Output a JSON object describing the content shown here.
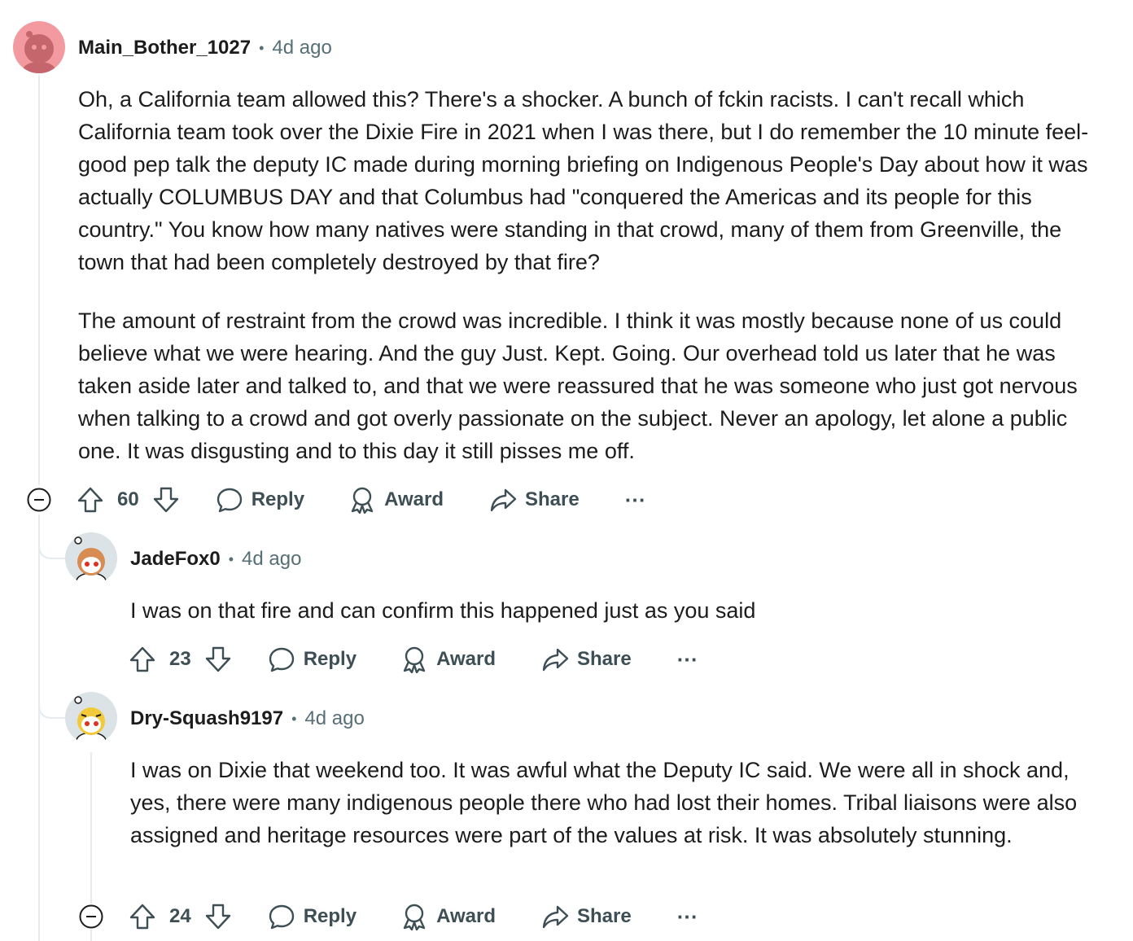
{
  "colors": {
    "text": "#1c1c1c",
    "meta": "#576f76",
    "action": "#3d4f55",
    "thread_line": "#e5ebee",
    "avatar1_bg": "#f39aa1",
    "avatar2_bg": "#dbe3e6",
    "avatar3_bg": "#dbe3e6"
  },
  "comments": [
    {
      "username": "Main_Bother_1027",
      "separator": "•",
      "time": "4d ago",
      "paragraphs": [
        "Oh, a California team allowed this? There's a shocker. A bunch of fckin racists. I can't recall which California team took over the Dixie Fire in 2021 when I was there, but I do remember the 10 minute feel-good pep talk the deputy IC made during morning briefing on Indigenous People's Day about how it was actually COLUMBUS DAY and that Columbus had \"conquered the Americas and its people for this country.\" You know how many natives were standing in that crowd, many of them from Greenville, the town that had been completely destroyed by that fire?",
        "The amount of restraint from the crowd was incredible. I think it was mostly because none of us could believe what we were hearing. And the guy Just. Kept. Going. Our overhead told us later that he was taken aside later and talked to, and that we were reassured that he was someone who just got nervous when talking to a crowd and got overly passionate on the subject. Never an apology, let alone a public one. It was disgusting and to this day it still pisses me off."
      ],
      "score": "60",
      "reply_label": "Reply",
      "award_label": "Award",
      "share_label": "Share",
      "more_label": "···"
    },
    {
      "username": "JadeFox0",
      "separator": "•",
      "time": "4d ago",
      "paragraphs": [
        "I was on that fire and can confirm this happened just as you said"
      ],
      "score": "23",
      "reply_label": "Reply",
      "award_label": "Award",
      "share_label": "Share",
      "more_label": "···"
    },
    {
      "username": "Dry-Squash9197",
      "separator": "•",
      "time": "4d ago",
      "paragraphs": [
        "I was on Dixie that weekend too. It was awful what the Deputy IC said. We were all in shock and, yes, there were many indigenous people there who had lost their homes. Tribal liaisons were also assigned and heritage resources were part of the values at risk. It was absolutely stunning."
      ],
      "score": "24",
      "reply_label": "Reply",
      "award_label": "Award",
      "share_label": "Share",
      "more_label": "···"
    }
  ]
}
